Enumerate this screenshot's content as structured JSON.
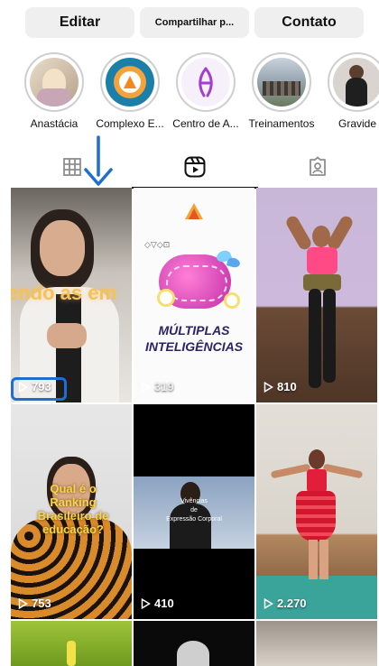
{
  "actions": {
    "edit_label": "Editar",
    "share_label": "Compartilhar p...",
    "contact_label": "Contato"
  },
  "stories": [
    {
      "label": "Anastácia"
    },
    {
      "label": "Complexo E..."
    },
    {
      "label": "Centro de A..."
    },
    {
      "label": "Treinamentos"
    },
    {
      "label": "Gravide"
    }
  ],
  "tabs": [
    {
      "name": "grid",
      "icon": "grid-icon"
    },
    {
      "name": "reels",
      "icon": "reels-icon"
    },
    {
      "name": "tagged",
      "icon": "tagged-icon"
    }
  ],
  "active_tab": "reels",
  "reels": [
    {
      "views": "793",
      "caption": "endo as em"
    },
    {
      "views": "319",
      "caption_line1": "MÚLTIPLAS",
      "caption_line2": "INTELIGÊNCIAS",
      "brand": "◇▽◇⊡"
    },
    {
      "views": "810"
    },
    {
      "views": "753",
      "caption": "Qual é o Ranking Brasileiro de educação?"
    },
    {
      "views": "410",
      "caption_line1": "Vivências",
      "caption_line2": "de",
      "caption_line3": "Expressão Corporal"
    },
    {
      "views": "2.270"
    }
  ],
  "colors": {
    "button_bg": "#efefef",
    "highlight": "#1e6fd1",
    "text": "#111111"
  }
}
